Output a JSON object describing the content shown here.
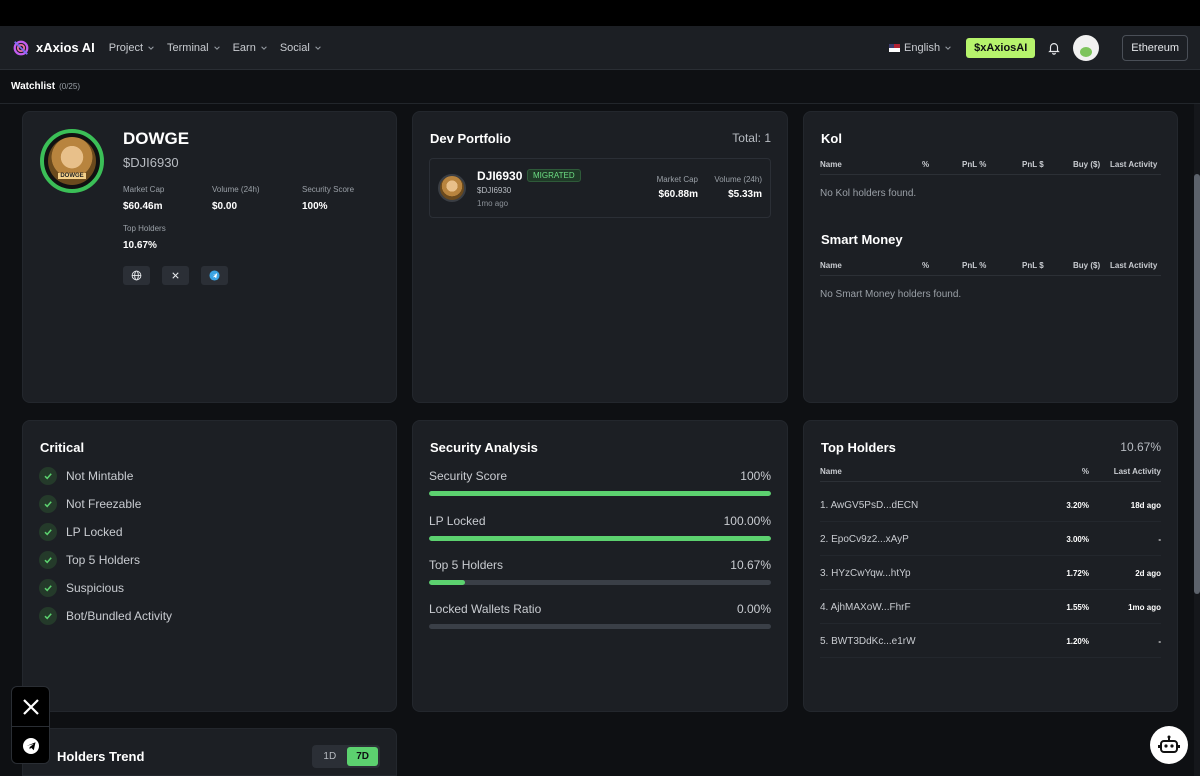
{
  "header": {
    "app_name": "xAxios AI",
    "nav": [
      {
        "label": "Project"
      },
      {
        "label": "Terminal"
      },
      {
        "label": "Earn"
      },
      {
        "label": "Social"
      }
    ],
    "language": "English",
    "token_button": "$xAxiosAI",
    "chain_button": "Ethereum"
  },
  "watchlist": {
    "title": "Watchlist",
    "count": "(0/25)"
  },
  "token": {
    "name": "DOWGE",
    "ticker": "$DJI6930",
    "logo_text": "DOWGE",
    "stats": [
      {
        "label": "Market Cap",
        "value": "$60.46m"
      },
      {
        "label": "Volume (24h)",
        "value": "$0.00"
      },
      {
        "label": "Security Score",
        "value": "100%"
      },
      {
        "label": "Top Holders",
        "value": "10.67%"
      }
    ],
    "links": [
      "globe-icon",
      "x-icon",
      "telegram-icon"
    ]
  },
  "dev_portfolio": {
    "title": "Dev Portfolio",
    "total": "Total: 1",
    "items": [
      {
        "name": "DJI6930",
        "badge": "MIGRATED",
        "ticker": "$DJI6930",
        "time": "1mo ago",
        "market_cap_label": "Market Cap",
        "market_cap": "$60.88m",
        "volume_label": "Volume (24h)",
        "volume": "$5.33m"
      }
    ]
  },
  "kol": {
    "title": "Kol",
    "columns": [
      "Name",
      "%",
      "PnL %",
      "PnL $",
      "Buy ($)",
      "Last Activity"
    ],
    "empty": "No Kol holders found."
  },
  "smart_money": {
    "title": "Smart Money",
    "columns": [
      "Name",
      "%",
      "PnL %",
      "PnL $",
      "Buy ($)",
      "Last Activity"
    ],
    "empty": "No Smart Money holders found."
  },
  "critical": {
    "title": "Critical",
    "items": [
      "Not Mintable",
      "Not Freezable",
      "LP Locked",
      "Top 5 Holders",
      "Suspicious",
      "Bot/Bundled Activity"
    ]
  },
  "security": {
    "title": "Security Analysis",
    "rows": [
      {
        "label": "Security Score",
        "value": "100%",
        "fill": 1.0
      },
      {
        "label": "LP Locked",
        "value": "100.00%",
        "fill": 1.0
      },
      {
        "label": "Top 5 Holders",
        "value": "10.67%",
        "fill": 0.1067
      },
      {
        "label": "Locked Wallets Ratio",
        "value": "0.00%",
        "fill": 0.0
      }
    ]
  },
  "top_holders": {
    "title": "Top Holders",
    "total": "10.67%",
    "columns": [
      "Name",
      "%",
      "Last Activity"
    ],
    "rows": [
      {
        "name": "1. AwGV5PsD...dECN",
        "pct": "3.20%",
        "activity": "18d ago"
      },
      {
        "name": "2. EpoCv9z2...xAyP",
        "pct": "3.00%",
        "activity": "-"
      },
      {
        "name": "3. HYzCwYqw...htYp",
        "pct": "1.72%",
        "activity": "2d ago"
      },
      {
        "name": "4. AjhMAXoW...FhrF",
        "pct": "1.55%",
        "activity": "1mo ago"
      },
      {
        "name": "5. BWT3DdKc...e1rW",
        "pct": "1.20%",
        "activity": "-"
      }
    ]
  },
  "holders_trend": {
    "title": "Holders Trend",
    "options": [
      "1D",
      "7D"
    ],
    "selected": "7D"
  },
  "colors": {
    "accent": "#5cd16f",
    "token_button": "#b6f36c",
    "card": "#1c1f24",
    "background": "#0e1013"
  }
}
